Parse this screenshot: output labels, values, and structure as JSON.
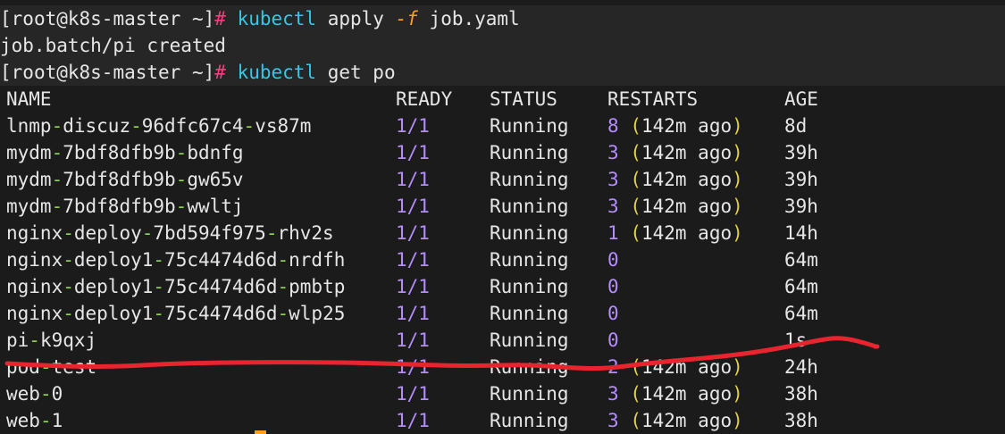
{
  "prompt": {
    "open": "[",
    "user_host": "root@k8s-master",
    "path": " ~",
    "close": "]",
    "symbol": "#"
  },
  "commands": [
    {
      "binary": "kubectl",
      "args_before": " apply ",
      "flag": "-f",
      "args_after": " job.yaml"
    },
    {
      "binary": "kubectl",
      "args_before": " get po",
      "flag": "",
      "args_after": ""
    }
  ],
  "apply_output": "job.batch/pi created",
  "table": {
    "headers": [
      "NAME",
      "READY",
      "STATUS",
      "RESTARTS",
      "AGE"
    ],
    "rows": [
      {
        "name": [
          "lnmp",
          "-",
          "discuz",
          "-",
          "96dfc67c4",
          "-",
          "vs87m"
        ],
        "ready": "1/1",
        "status": "Running",
        "restarts": "8",
        "restart_age": "142m ago",
        "age": "8d"
      },
      {
        "name": [
          "mydm",
          "-",
          "7bdf8dfb9b",
          "-",
          "bdnfg"
        ],
        "ready": "1/1",
        "status": "Running",
        "restarts": "3",
        "restart_age": "142m ago",
        "age": "39h"
      },
      {
        "name": [
          "mydm",
          "-",
          "7bdf8dfb9b",
          "-",
          "gw65v"
        ],
        "ready": "1/1",
        "status": "Running",
        "restarts": "3",
        "restart_age": "142m ago",
        "age": "39h"
      },
      {
        "name": [
          "mydm",
          "-",
          "7bdf8dfb9b",
          "-",
          "wwltj"
        ],
        "ready": "1/1",
        "status": "Running",
        "restarts": "3",
        "restart_age": "142m ago",
        "age": "39h"
      },
      {
        "name": [
          "nginx",
          "-",
          "deploy",
          "-",
          "7bd594f975",
          "-",
          "rhv2s"
        ],
        "ready": "1/1",
        "status": "Running",
        "restarts": "1",
        "restart_age": "142m ago",
        "age": "14h"
      },
      {
        "name": [
          "nginx",
          "-",
          "deploy1",
          "-",
          "75c4474d6d",
          "-",
          "nrdfh"
        ],
        "ready": "1/1",
        "status": "Running",
        "restarts": "0",
        "restart_age": "",
        "age": "64m"
      },
      {
        "name": [
          "nginx",
          "-",
          "deploy1",
          "-",
          "75c4474d6d",
          "-",
          "pmbtp"
        ],
        "ready": "1/1",
        "status": "Running",
        "restarts": "0",
        "restart_age": "",
        "age": "64m"
      },
      {
        "name": [
          "nginx",
          "-",
          "deploy1",
          "-",
          "75c4474d6d",
          "-",
          "wlp25"
        ],
        "ready": "1/1",
        "status": "Running",
        "restarts": "0",
        "restart_age": "",
        "age": "64m"
      },
      {
        "name": [
          "pi",
          "-",
          "k9qxj"
        ],
        "ready": "1/1",
        "status": "Running",
        "restarts": "0",
        "restart_age": "",
        "age": "1s"
      },
      {
        "name": [
          "pod",
          "-",
          "test"
        ],
        "ready": "1/1",
        "status": "Running",
        "restarts": "2",
        "restart_age": "142m ago",
        "age": "24h"
      },
      {
        "name": [
          "web",
          "-",
          "0"
        ],
        "ready": "1/1",
        "status": "Running",
        "restarts": "3",
        "restart_age": "142m ago",
        "age": "38h"
      },
      {
        "name": [
          "web",
          "-",
          "1"
        ],
        "ready": "1/1",
        "status": "Running",
        "restarts": "3",
        "restart_age": "142m ago",
        "age": "38h"
      }
    ]
  },
  "colors": {
    "background": "#1b1b1b",
    "prompt_hash": "#ff3b7f",
    "kubectl": "#33c7e8",
    "flag": "#ff9f1a",
    "name_dash": "#8bd14a",
    "numbers": "#b48cff",
    "parens": "#e0d04a",
    "annotation_stroke": "#e8242f"
  },
  "annotation": {
    "kind": "red-freehand-strikethrough",
    "target_row": "pod-test"
  }
}
